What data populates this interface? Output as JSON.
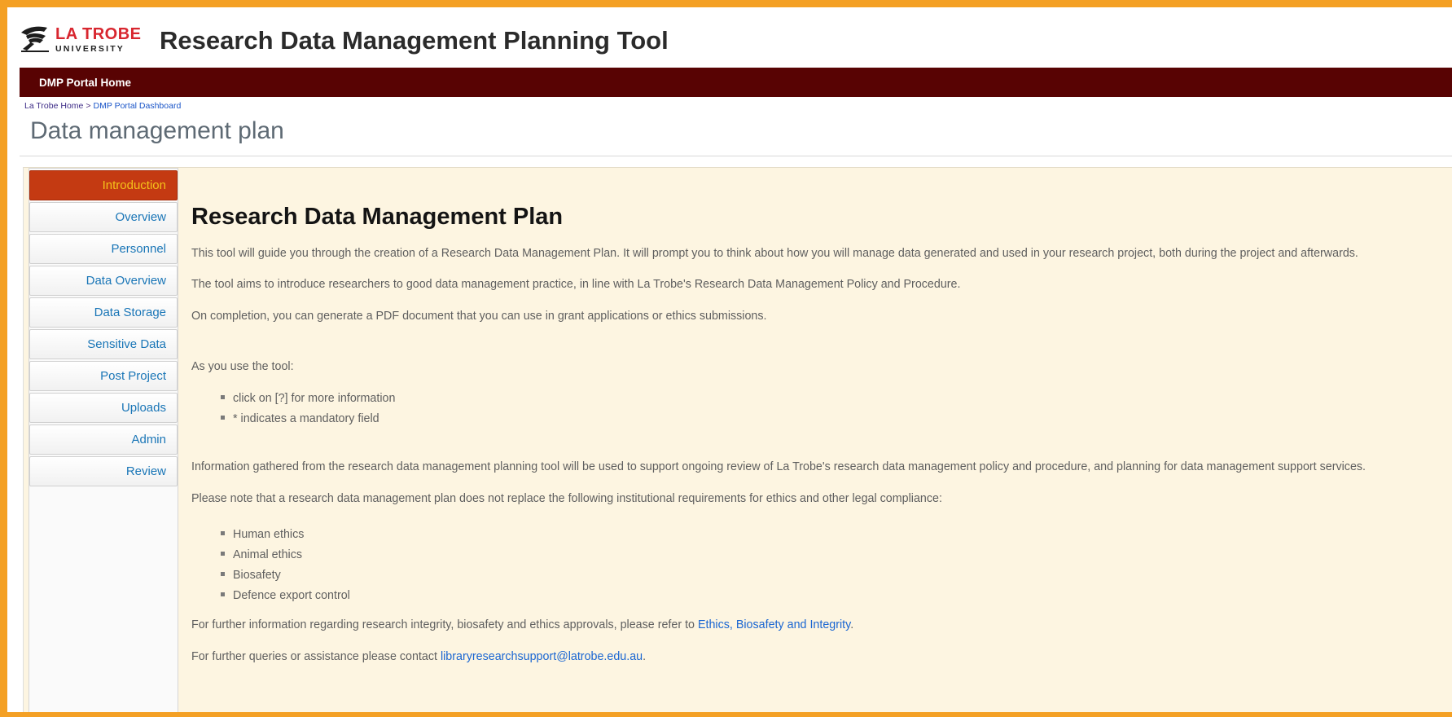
{
  "header": {
    "logo_main": "LA TROBE",
    "logo_sub": "UNIVERSITY",
    "app_title": "Research Data Management Planning Tool"
  },
  "navbar": {
    "home_link": "DMP Portal Home"
  },
  "breadcrumb": {
    "items": [
      "La Trobe Home",
      "DMP Portal Dashboard"
    ],
    "separator": ">"
  },
  "page": {
    "title": "Data management plan"
  },
  "sidebar": {
    "active_index": 0,
    "items": [
      {
        "label": "Introduction"
      },
      {
        "label": "Overview"
      },
      {
        "label": "Personnel"
      },
      {
        "label": "Data Overview"
      },
      {
        "label": "Data Storage"
      },
      {
        "label": "Sensitive Data"
      },
      {
        "label": "Post Project"
      },
      {
        "label": "Uploads"
      },
      {
        "label": "Admin"
      },
      {
        "label": "Review"
      }
    ]
  },
  "main": {
    "heading": "Research Data Management Plan",
    "intro_paragraphs": [
      "This tool will guide you through the creation of a Research Data Management Plan. It will prompt you to think about how you will manage data generated and used in your research project, both during the project and afterwards.",
      "The tool aims to introduce researchers to good data management practice, in line with La Trobe's Research Data Management Policy and Procedure.",
      "On completion, you can generate a PDF document that you can use in grant applications or ethics submissions."
    ],
    "usage_intro": "As you use the tool:",
    "usage_items": [
      "click on [?] for more information",
      "* indicates a mandatory field"
    ],
    "info_paragraph": "Information gathered from the research data management planning tool will be used to support ongoing review of La Trobe's research data management policy and procedure, and planning for data management support services.",
    "requirements_intro": "Please note that a research data management plan does not replace the following institutional requirements for ethics and other legal compliance:",
    "requirements": [
      "Human ethics",
      "Animal ethics",
      "Biosafety",
      "Defence export control"
    ],
    "further_info_text": "For further information regarding research integrity, biosafety and ethics approvals, please refer to ",
    "further_info_link": "Ethics, Biosafety and Integrity",
    "further_info_end": ".",
    "contact_text": "For further queries or assistance please contact ",
    "contact_link": "libraryresearchsupport@latrobe.edu.au",
    "contact_end": "."
  },
  "colors": {
    "frame": "#f4a024",
    "navbar": "#580303",
    "content_bg": "#fdf5e1",
    "active_tab": "#c43a12",
    "active_tab_text": "#f5c21a",
    "link": "#1a66d2"
  }
}
